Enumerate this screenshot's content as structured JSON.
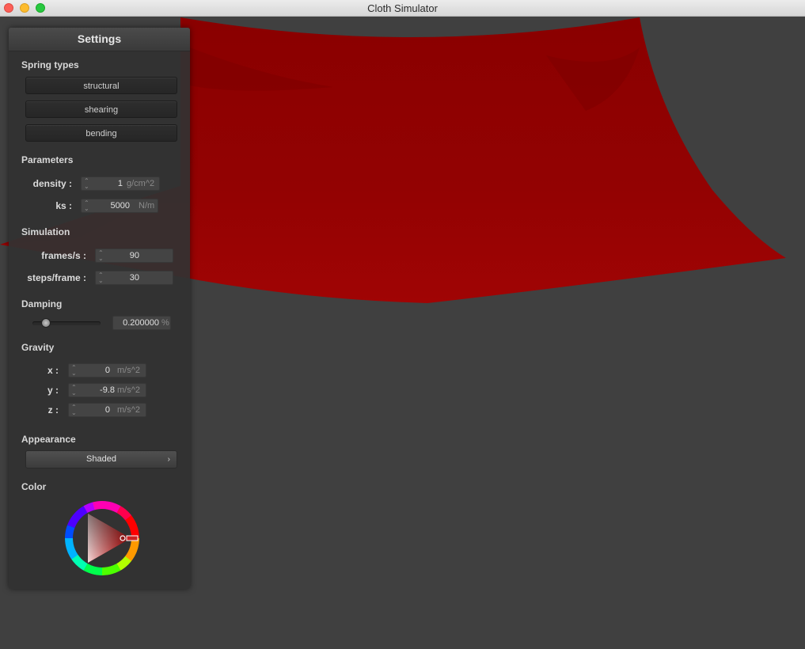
{
  "window": {
    "title": "Cloth Simulator"
  },
  "panel": {
    "title": "Settings",
    "spring_types": {
      "heading": "Spring types",
      "buttons": [
        "structural",
        "shearing",
        "bending"
      ]
    },
    "parameters": {
      "heading": "Parameters",
      "density": {
        "label": "density :",
        "value": "1",
        "unit": "g/cm^2"
      },
      "ks": {
        "label": "ks :",
        "value": "5000",
        "unit": "N/m"
      }
    },
    "simulation": {
      "heading": "Simulation",
      "fps": {
        "label": "frames/s :",
        "value": "90"
      },
      "steps": {
        "label": "steps/frame :",
        "value": "30"
      }
    },
    "damping": {
      "heading": "Damping",
      "value": "0.200000",
      "unit": "%",
      "slider_fraction": 0.2
    },
    "gravity": {
      "heading": "Gravity",
      "x": {
        "label": "x :",
        "value": "0",
        "unit": "m/s^2"
      },
      "y": {
        "label": "y :",
        "value": "-9.8",
        "unit": "m/s^2"
      },
      "z": {
        "label": "z :",
        "value": "0",
        "unit": "m/s^2"
      }
    },
    "appearance": {
      "heading": "Appearance",
      "selected": "Shaded",
      "arrow": "›"
    },
    "color": {
      "heading": "Color",
      "selected_hex": "#8b0000"
    }
  },
  "colors": {
    "cloth": "#8b0000",
    "background": "#404040"
  }
}
